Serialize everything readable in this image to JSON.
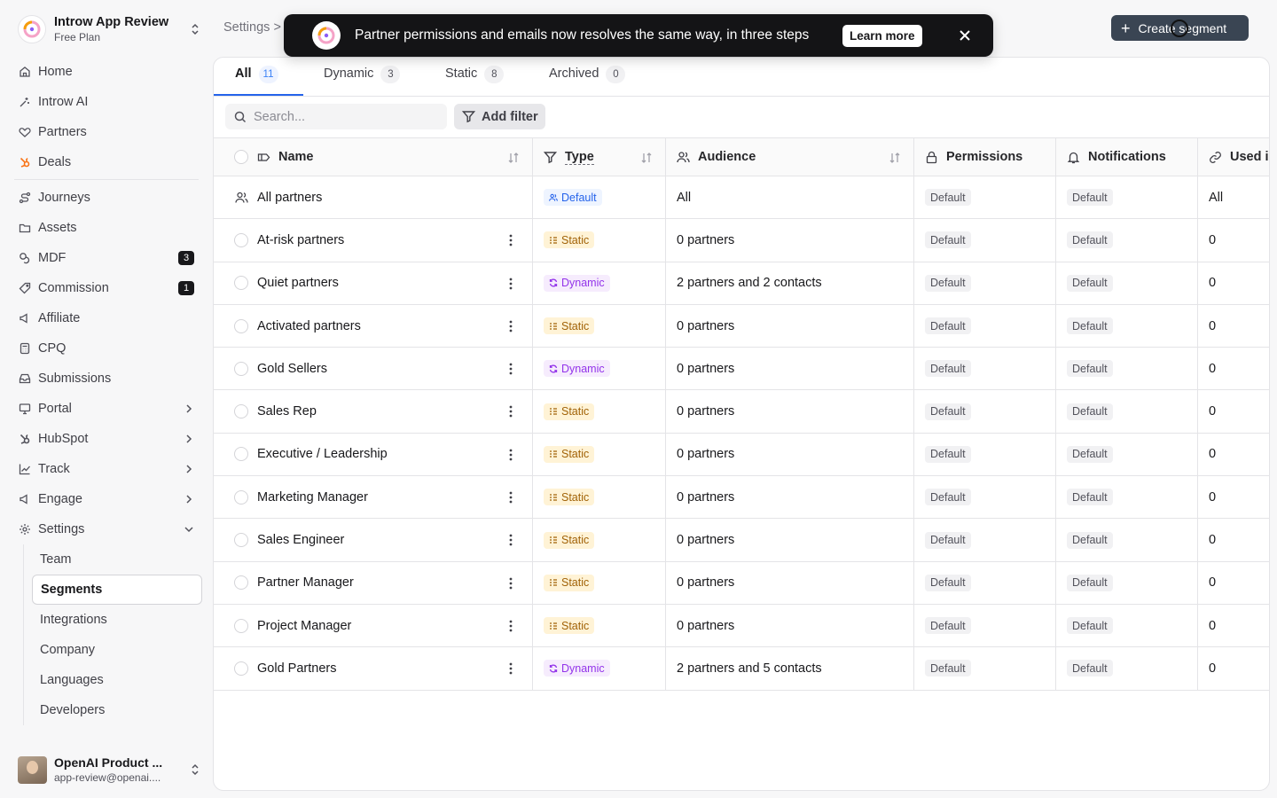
{
  "workspace": {
    "name": "Introw App Review",
    "plan": "Free Plan"
  },
  "nav": {
    "main": [
      {
        "label": "Home",
        "icon": "home-icon"
      },
      {
        "label": "Introw AI",
        "icon": "sparkle-icon"
      },
      {
        "label": "Partners",
        "icon": "handshake-icon"
      },
      {
        "label": "Deals",
        "icon": "hubspot-icon"
      }
    ],
    "secondary": [
      {
        "label": "Journeys",
        "icon": "route-icon"
      },
      {
        "label": "Assets",
        "icon": "folder-icon"
      },
      {
        "label": "MDF",
        "icon": "coins-icon",
        "badge": "3"
      },
      {
        "label": "Commission",
        "icon": "tag-icon",
        "badge": "1"
      },
      {
        "label": "Affiliate",
        "icon": "megaphone-icon"
      },
      {
        "label": "CPQ",
        "icon": "calculator-icon"
      },
      {
        "label": "Submissions",
        "icon": "inbox-icon"
      },
      {
        "label": "Portal",
        "icon": "monitor-icon"
      },
      {
        "label": "HubSpot",
        "icon": "hubspot-icon"
      },
      {
        "label": "Track",
        "icon": "chart-icon"
      },
      {
        "label": "Engage",
        "icon": "megaphone-icon"
      },
      {
        "label": "Settings",
        "icon": "gear-icon"
      }
    ],
    "settings_sub": [
      "Team",
      "Segments",
      "Integrations",
      "Company",
      "Languages",
      "Developers"
    ]
  },
  "user": {
    "name": "OpenAI Product ...",
    "email": "app-review@openai...."
  },
  "breadcrumb": {
    "root": "Settings",
    "sep": ">"
  },
  "create_button": "Create segment",
  "toast": {
    "message": "Partner permissions and emails now resolves the same way, in three steps",
    "action": "Learn more"
  },
  "tabs": [
    {
      "label": "All",
      "count": "11"
    },
    {
      "label": "Dynamic",
      "count": "3"
    },
    {
      "label": "Static",
      "count": "8"
    },
    {
      "label": "Archived",
      "count": "0"
    }
  ],
  "search": {
    "placeholder": "Search..."
  },
  "filter_button": "Add filter",
  "columns": {
    "name": "Name",
    "type": "Type",
    "audience": "Audience",
    "permissions": "Permissions",
    "notifications": "Notifications",
    "used": "Used i"
  },
  "rows": [
    {
      "name": "All partners",
      "type": "Default",
      "audience": "All",
      "permissions": "Default",
      "notifications": "Default",
      "used": "All"
    },
    {
      "name": "At-risk partners",
      "type": "Static",
      "audience": "0 partners",
      "permissions": "Default",
      "notifications": "Default",
      "used": "0"
    },
    {
      "name": "Quiet partners",
      "type": "Dynamic",
      "audience": "2 partners and 2 contacts",
      "permissions": "Default",
      "notifications": "Default",
      "used": "0"
    },
    {
      "name": "Activated partners",
      "type": "Static",
      "audience": "0 partners",
      "permissions": "Default",
      "notifications": "Default",
      "used": "0"
    },
    {
      "name": "Gold Sellers",
      "type": "Dynamic",
      "audience": "0 partners",
      "permissions": "Default",
      "notifications": "Default",
      "used": "0"
    },
    {
      "name": "Sales Rep",
      "type": "Static",
      "audience": "0 partners",
      "permissions": "Default",
      "notifications": "Default",
      "used": "0"
    },
    {
      "name": "Executive / Leadership",
      "type": "Static",
      "audience": "0 partners",
      "permissions": "Default",
      "notifications": "Default",
      "used": "0"
    },
    {
      "name": "Marketing Manager",
      "type": "Static",
      "audience": "0 partners",
      "permissions": "Default",
      "notifications": "Default",
      "used": "0"
    },
    {
      "name": "Sales Engineer",
      "type": "Static",
      "audience": "0 partners",
      "permissions": "Default",
      "notifications": "Default",
      "used": "0"
    },
    {
      "name": "Partner Manager",
      "type": "Static",
      "audience": "0 partners",
      "permissions": "Default",
      "notifications": "Default",
      "used": "0"
    },
    {
      "name": "Project Manager",
      "type": "Static",
      "audience": "0 partners",
      "permissions": "Default",
      "notifications": "Default",
      "used": "0"
    },
    {
      "name": "Gold Partners",
      "type": "Dynamic",
      "audience": "2 partners and 5 contacts",
      "permissions": "Default",
      "notifications": "Default",
      "used": "0"
    }
  ],
  "colors": {
    "accent": "#2563eb",
    "static": "#a16207",
    "dynamic": "#9333ea",
    "default": "#2563eb",
    "toast_bg": "#141416"
  }
}
